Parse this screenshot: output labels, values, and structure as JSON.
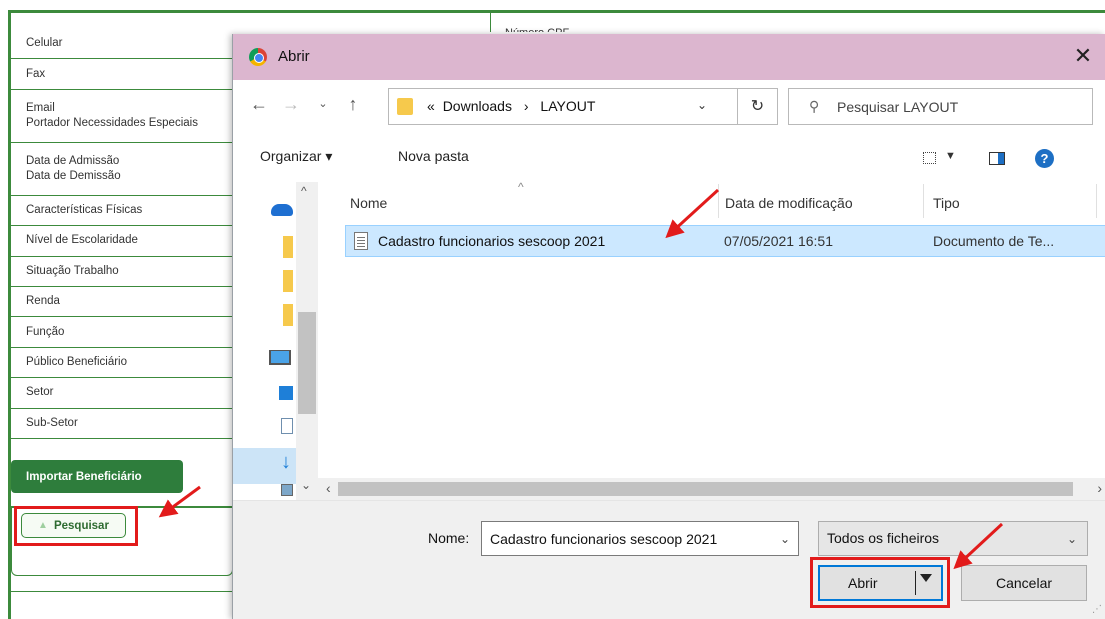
{
  "background": {
    "header_partial": "Número CPF ...",
    "fields": [
      "Celular",
      "Fax",
      "Email",
      "Portador Necessidades Especiais",
      "Data de Admissão",
      "Data de Demissão",
      "Características Físicas",
      "Nível de Escolaridade",
      "Situação Trabalho",
      "Renda",
      "Função",
      "Público Beneficiário",
      "Setor",
      "Sub-Setor"
    ],
    "import_button": "Importar Beneficiário",
    "search_button": "Pesquisar"
  },
  "dialog": {
    "title": "Abrir",
    "address": {
      "prefix": "«",
      "crumbs": [
        "Downloads",
        "LAYOUT"
      ],
      "separator": "›"
    },
    "search_placeholder": "Pesquisar LAYOUT",
    "toolbar": {
      "organize": "Organizar ▾",
      "new_folder": "Nova pasta"
    },
    "columns": {
      "name": "Nome",
      "date": "Data de modificação",
      "type": "Tipo"
    },
    "file": {
      "name": "Cadastro funcionarios sescoop 2021",
      "date": "07/05/2021 16:51",
      "type": "Documento de Te..."
    },
    "filename_label": "Nome:",
    "filename_value": "Cadastro funcionarios sescoop 2021",
    "filter": "Todos os ficheiros",
    "open_button": "Abrir",
    "cancel_button": "Cancelar"
  },
  "colors": {
    "brand_green": "#2e7d3c",
    "titlebar": "#dcb6cf",
    "selection": "#cce8ff",
    "highlight_red": "#e21b1b"
  }
}
